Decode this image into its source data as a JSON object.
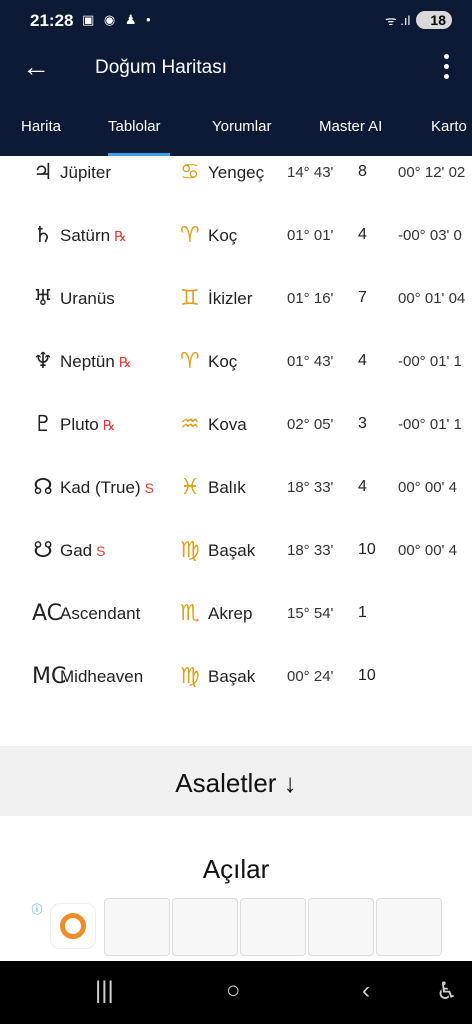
{
  "status": {
    "time": "21:28",
    "icons": "▣ ◉ ♟ •",
    "signal": "ᯤ .ıl",
    "battery": "18"
  },
  "appbar": {
    "back": "←",
    "title": "Doğum Haritası"
  },
  "tabs": [
    "Harita",
    "Tablolar",
    "Yorumlar",
    "Master AI",
    "Karto"
  ],
  "rows": [
    {
      "psym": "♃",
      "name": "Jüpiter",
      "retro": "",
      "ssym": "♋",
      "sign": "Yengeç",
      "deg": "14° 43'",
      "house": "8",
      "speed": "00° 12' 02"
    },
    {
      "psym": "♄",
      "name": "Satürn",
      "retro": "℞",
      "ssym": "♈",
      "sign": "Koç",
      "deg": "01° 01'",
      "house": "4",
      "speed": "-00° 03' 0"
    },
    {
      "psym": "♅",
      "name": "Uranüs",
      "retro": "",
      "ssym": "♊",
      "sign": "İkizler",
      "deg": "01° 16'",
      "house": "7",
      "speed": "00° 01' 04"
    },
    {
      "psym": "♆",
      "name": "Neptün",
      "retro": "℞",
      "ssym": "♈",
      "sign": "Koç",
      "deg": "01° 43'",
      "house": "4",
      "speed": "-00° 01' 1"
    },
    {
      "psym": "♇",
      "name": "Pluto",
      "retro": "℞",
      "ssym": "♒",
      "sign": "Kova",
      "deg": "02° 05'",
      "house": "3",
      "speed": "-00° 01' 1"
    },
    {
      "psym": "☊",
      "name": "Kad (True)",
      "retro": "S",
      "ssym": "♓",
      "sign": "Balık",
      "deg": "18° 33'",
      "house": "4",
      "speed": "00° 00' 4"
    },
    {
      "psym": "☋",
      "name": "Gad",
      "retro": "S",
      "ssym": "♍",
      "sign": "Başak",
      "deg": "18° 33'",
      "house": "10",
      "speed": "00° 00' 4"
    },
    {
      "psym": "AC",
      "name": "Ascendant",
      "retro": "",
      "ssym": "♏",
      "sign": "Akrep",
      "deg": "15° 54'",
      "house": "1",
      "speed": ""
    },
    {
      "psym": "MC",
      "name": "Midheaven",
      "retro": "",
      "ssym": "♍",
      "sign": "Başak",
      "deg": "00° 24'",
      "house": "10",
      "speed": ""
    }
  ],
  "sections": {
    "asaletler": "Asaletler ↓",
    "acilar": "Açılar"
  },
  "ad": {
    "info": "ⓘ"
  },
  "nav": {
    "recents": "|||",
    "home": "○",
    "back": "‹",
    "accessibility": "♿"
  },
  "colors": {
    "header": "#0c1a36",
    "tab_indicator": "#3aa0e8",
    "sign_symbol": "#e0a11a",
    "retro": "#e53935"
  }
}
